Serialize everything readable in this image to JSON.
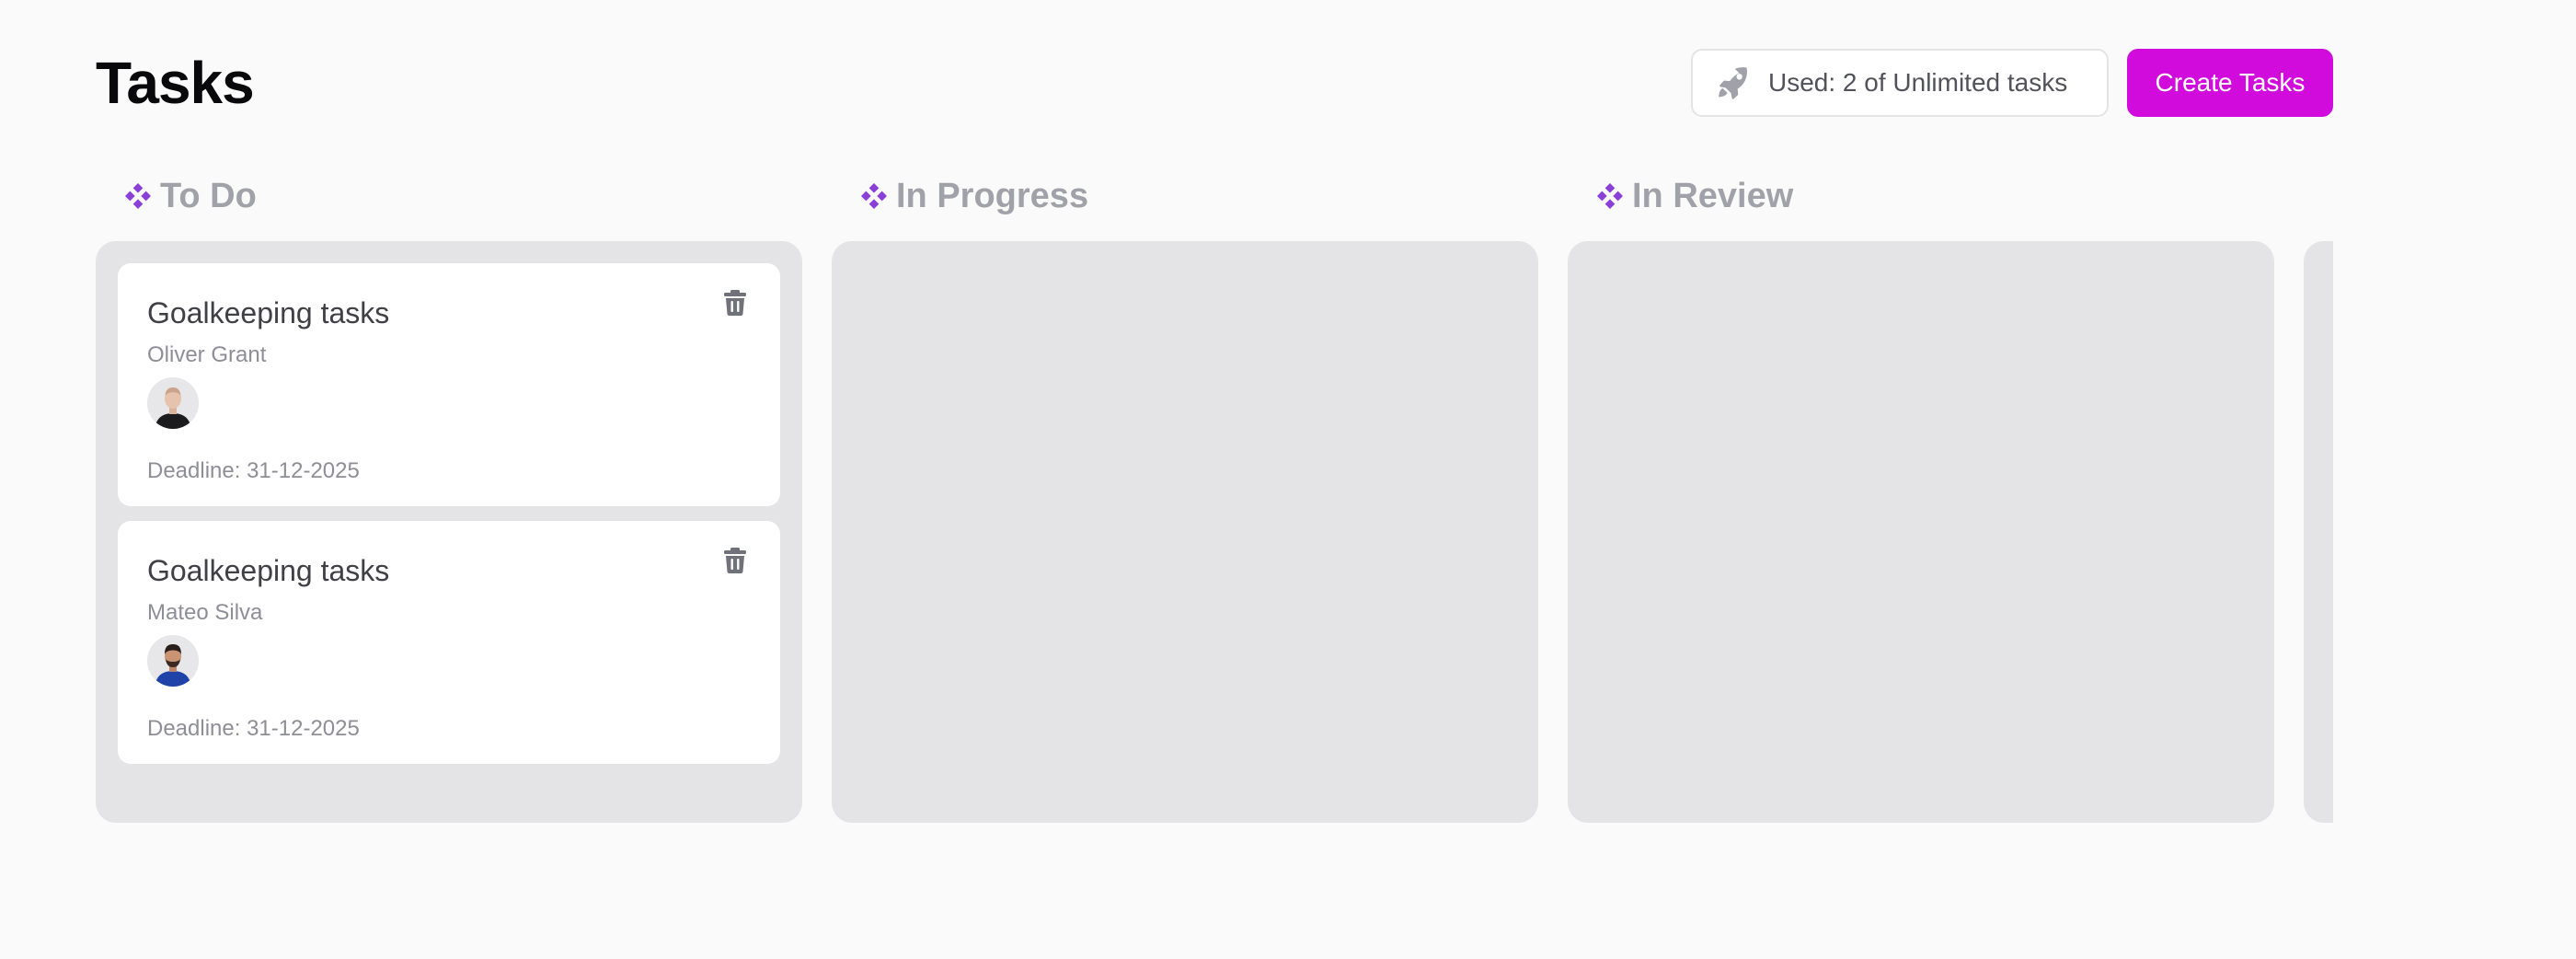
{
  "header": {
    "title": "Tasks",
    "usage_label": "Used: 2 of Unlimited tasks",
    "create_label": "Create Tasks"
  },
  "colors": {
    "accent": "#d10bdc",
    "column_icon": "#8b3fd9",
    "column_bg": "#e4e4e7"
  },
  "columns": [
    {
      "title": "To Do",
      "icon": "diamond-grid-icon",
      "tasks": [
        {
          "title": "Goalkeeping tasks",
          "assignee": "Oliver Grant",
          "deadline": "Deadline: 31-12-2025",
          "avatar": "avatar-photo"
        },
        {
          "title": "Goalkeeping tasks",
          "assignee": "Mateo Silva",
          "deadline": "Deadline: 31-12-2025",
          "avatar": "avatar-photo"
        }
      ]
    },
    {
      "title": "In Progress",
      "icon": "diamond-grid-icon",
      "tasks": []
    },
    {
      "title": "In Review",
      "icon": "diamond-grid-icon",
      "tasks": []
    }
  ]
}
